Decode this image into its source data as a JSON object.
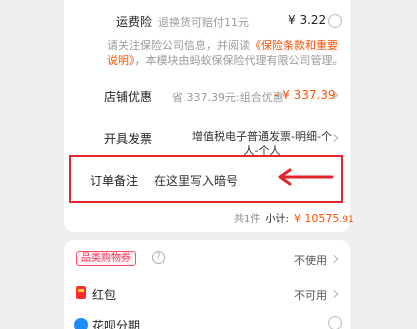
{
  "shipping_insurance": {
    "label": "运费险",
    "desc": "退换货可赔付11元",
    "price": "¥ 3.22"
  },
  "notice": {
    "text_before": "请关注保险公司信息，并阅读",
    "link_text": "《保险条款和重要说明》",
    "text_after": "，本模块由蚂蚁保保险代理有限公司管理。"
  },
  "store_discount": {
    "label": "店铺优惠",
    "desc": "省 337.39元:组合优惠",
    "value": "- ¥ 337.39"
  },
  "invoice": {
    "label": "开具发票",
    "value": "增值税电子普通发票-明细-个人-个人"
  },
  "order_note": {
    "label": "订单备注",
    "placeholder": "在这里写入暗号"
  },
  "subtotal": {
    "count_text": "共1件",
    "label": "小计:",
    "value_main": "¥ 10575",
    "value_decimal": ".91"
  },
  "coupon": {
    "label": "品类购物券",
    "value": "不使用"
  },
  "red_packet": {
    "label": "红包",
    "value": "不可用"
  },
  "huabei": {
    "label": "花呗分期"
  },
  "colors": {
    "accent": "#ff5000",
    "highlight_red": "#e3262b",
    "background": "#efefef"
  }
}
